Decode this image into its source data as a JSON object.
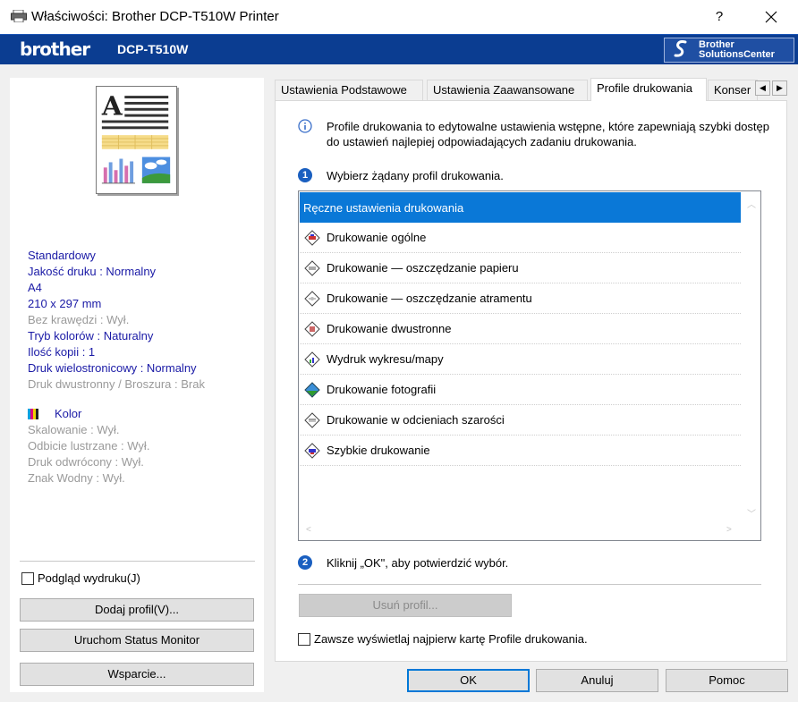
{
  "window": {
    "title": "Właściwości: Brother DCP-T510W Printer",
    "help_label": "?"
  },
  "brand": {
    "logo": "brother",
    "model": "DCP-T510W",
    "solutions_center_line1": "Brother",
    "solutions_center_line2": "SolutionsCenter",
    "accent_color": "#0b3d91"
  },
  "left_panel": {
    "settings": [
      {
        "text": "Standardowy",
        "style": "blue"
      },
      {
        "text": "Jakość druku : Normalny",
        "style": "blue"
      },
      {
        "text": "A4",
        "style": "blue"
      },
      {
        "text": "210 x 297 mm",
        "style": "blue"
      },
      {
        "text": "Bez krawędzi : Wył.",
        "style": "gray"
      },
      {
        "text": "Tryb kolorów : Naturalny",
        "style": "blue"
      },
      {
        "text": "Ilość kopii  : 1",
        "style": "blue"
      },
      {
        "text": "Druk wielostronicowy  : Normalny",
        "style": "blue"
      },
      {
        "text": "Druk dwustronny / Broszura : Brak",
        "style": "gray"
      }
    ],
    "color_label": "Kolor",
    "settings2": [
      {
        "text": "Skalowanie : Wył."
      },
      {
        "text": "Odbicie lustrzane  : Wył."
      },
      {
        "text": "Druk odwrócony  : Wył."
      },
      {
        "text": "Znak Wodny : Wył."
      }
    ],
    "preview_checkbox_label": "Podgląd wydruku(J)",
    "buttons": {
      "add_profile": "Dodaj profil(V)...",
      "status_monitor": "Uruchom Status Monitor",
      "support": "Wsparcie..."
    }
  },
  "tabs": [
    {
      "label": "Ustawienia Podstawowe",
      "active": false
    },
    {
      "label": "Ustawienia Zaawansowane",
      "active": false
    },
    {
      "label": "Profile drukowania",
      "active": true
    },
    {
      "label": "Konser",
      "active": false
    }
  ],
  "content": {
    "info_text": "Profile drukowania to edytowalne ustawienia wstępne, które zapewniają szybki dostęp do ustawień najlepiej odpowiadających zadaniu drukowania.",
    "step1_num": "1",
    "step1_text": "Wybierz żądany profil drukowania.",
    "profiles": [
      {
        "label": "Ręczne ustawienia drukowania",
        "selected": true,
        "icon": "none"
      },
      {
        "label": "Drukowanie ogólne",
        "selected": false,
        "icon": "general-print-icon"
      },
      {
        "label": "Drukowanie — oszczędzanie papieru",
        "selected": false,
        "icon": "paper-saving-icon"
      },
      {
        "label": "Drukowanie — oszczędzanie atramentu",
        "selected": false,
        "icon": "ink-saving-icon"
      },
      {
        "label": "Drukowanie dwustronne",
        "selected": false,
        "icon": "duplex-print-icon"
      },
      {
        "label": "Wydruk wykresu/mapy",
        "selected": false,
        "icon": "chart-map-icon"
      },
      {
        "label": "Drukowanie fotografii",
        "selected": false,
        "icon": "photo-print-icon"
      },
      {
        "label": "Drukowanie w odcieniach szarości",
        "selected": false,
        "icon": "grayscale-print-icon"
      },
      {
        "label": "Szybkie drukowanie",
        "selected": false,
        "icon": "fast-print-icon"
      }
    ],
    "step2_num": "2",
    "step2_text": "Kliknij „OK\", aby potwierdzić wybór.",
    "delete_profile_label": "Usuń profil...",
    "always_show_label": "Zawsze wyświetlaj najpierw kartę Profile drukowania."
  },
  "footer": {
    "ok": "OK",
    "cancel": "Anuluj",
    "help": "Pomoc"
  }
}
